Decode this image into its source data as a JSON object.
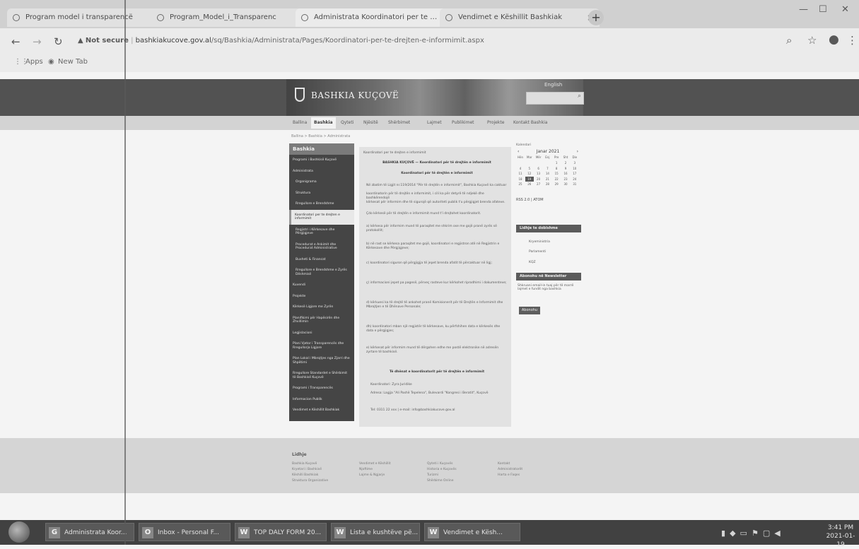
{
  "tabs": [
    {
      "title": "Program model i transparencë",
      "active": false
    },
    {
      "title": "Program_Model_i_Transparenc",
      "active": false
    },
    {
      "title": "Administrata Koordinatori per te …",
      "active": true
    },
    {
      "title": "Vendimet e Këshillit Bashkiak",
      "active": false
    }
  ],
  "new_tab": "+",
  "address": {
    "security": "Not secure",
    "host": "bashkiakucove.gov.al",
    "path": "/sq/Bashkia/Administrata/Pages/Koordinatori-per-te-drejten-e-informimit.aspx"
  },
  "bookmarks": [
    "Apps",
    "New Tab"
  ],
  "site": {
    "title": "BASHKIA KUÇOVË",
    "language_link": "English",
    "menu": [
      "Ballina",
      "Bashkia",
      "Qyteti",
      "Njësitë",
      "Shërbimet",
      "Lajmet",
      "Publikimet",
      "Projekte",
      "Kontakt Bashkia"
    ],
    "active_menu": 1,
    "breadcrumb": "Ballina > Bashkia > Administrata"
  },
  "sidebar": {
    "header": "Bashkia",
    "items": [
      "Programi i Bashkisë Kuçovë",
      "Administrata",
      "Organigrama",
      "Struktura",
      "Rregullore e Brendshme",
      "Koordinatori per te drejten e informimit",
      "Regjistri i Kërkesave dhe Përgjigjeve",
      "Procedurat e Ankimit dhe Procedurat Administrative",
      "Buxheti & Financat",
      "Rregullore e Brendshme e Zyrës Dëshmisë",
      "Kuvendi",
      "Projekte",
      "Kërkesë Ligjore me Zyrën",
      "Planifikimi për Hapësirën dhe Zhvillimin",
      "Legjislacioni",
      "Plani Vjetor i Transparencës dhe Rregullorja Ligjore",
      "Plan Lokal i Mbrojtjes nga Zjarri dhe Shpëtimi",
      "Rregullore Standardet e Shërbimit të Bashkisë Kuçovë",
      "Programi i Transparencës",
      "Informacion Publik",
      "Vendimet e Këshillit Bashkiak"
    ],
    "active_index": 5
  },
  "content": {
    "crumb": "Koordinatori per te drejten e informimit",
    "h1": "BASHKIA KUÇOVË — Koordinatori për të drejtën e informimit",
    "h2": "Koordinatori për të drejtën e informimit",
    "paras": [
      "Në zbatim të Ligjit nr.119/2014 \"Për të drejtën e informimit\", Bashkia Kuçovë ka caktuar",
      "koordinatorin për të drejtën e informimit, i cili ka për detyrë të ndjekë dhe bashkërendojë",
      "kërkesat për informim dhe të sigurojë që autoriteti publik t'u përgjigjet brenda afateve.",
      "Çdo kërkesë për të drejtën e informimit mund t'i drejtohet koordinatorit.",
      "a) kërkesa për informim mund të paraqitet me shkrim ose me gojë pranë zyrës së protokollit;",
      "b) në rast se kërkesa paraqitet me gojë, koordinatori e regjistron atë në Regjistrin e Kërkesave dhe Përgjigjeve;",
      "c) koordinatori siguron që përgjigjja të jepet brenda afatit të përcaktuar në ligj;",
      "ç) informacioni jepet pa pagesë, përveç rasteve kur kërkohet riprodhimi i dokumenteve;",
      "d) kërkuesi ka të drejtë të ankohet pranë Komisionerit për të Drejtën e Informimit dhe Mbrojtjen e të Dhënave Personale;",
      "dh) koordinatori mban një regjistër të kërkesave, ku përfshihen data e kërkesës dhe data e përgjigjes;",
      "e) kërkesat për informim mund të dërgohen edhe me postë elektronike në adresën zyrtare të bashkisë."
    ],
    "contact_head": "Të dhënat e koordinatorit për të drejtën e informimit",
    "contacts": [
      "Koordinatori: Zyra Juridike",
      "Adresa: Lagjja \"Ali Pashë Tepelena\", Bulevardi \"Kongresi i Beratit\", Kuçovë",
      "Tel: 0311 22 xxx | e-mail: info@bashkiakucove.gov.al"
    ]
  },
  "calendar": {
    "label": "Kalendari",
    "month": "Janar 2021",
    "weekdays": [
      "Hën",
      "Mar",
      "Mër",
      "Enj",
      "Pre",
      "Sht",
      "Die"
    ],
    "today": "19"
  },
  "rss": "RSS 2.0 | ATOM",
  "widgets": {
    "links_head": "Lidhje te dobishme",
    "links": [
      "Kryeministria",
      "Parlamenti",
      "KQZ"
    ],
    "newsletter_head": "Abonohu në Newsletter",
    "newsletter_text": "Shkruani email-in tuaj për të marrë lajmet e fundit nga bashkia",
    "button": "Abonohu"
  },
  "footer": {
    "heading": "Lidhje",
    "cols": [
      [
        "Bashkia Kuçovë",
        "Kryetari i Bashkisë",
        "Këshilli Bashkiak",
        "Struktura Organizative"
      ],
      [
        "Vendimet e Këshillit",
        "Njoftime",
        "Lajme & Ngjarje"
      ],
      [
        "Qyteti i Kuçovës",
        "Historia e Kuçovës",
        "Turizmi",
        "Shërbime Online"
      ],
      [
        "Kontakt",
        "Administratorët",
        "Harta e Faqes"
      ]
    ]
  },
  "taskbar": {
    "buttons": [
      {
        "label": "Administrata Koor...",
        "icon": "G"
      },
      {
        "label": "Inbox - Personal F...",
        "icon": "O"
      },
      {
        "label": "TOP DALY FORM 20...",
        "icon": "W"
      },
      {
        "label": "Lista e kushtëve pë...",
        "icon": "W"
      },
      {
        "label": "Vendimet e Kësh...",
        "icon": "W"
      }
    ],
    "time": "3:41 PM",
    "date": "2021-01-19"
  }
}
